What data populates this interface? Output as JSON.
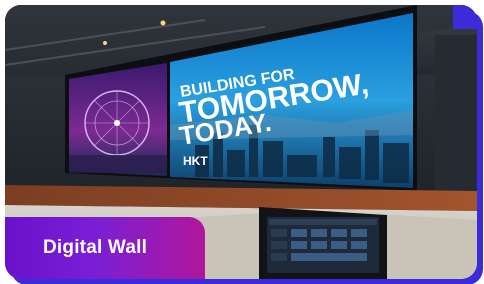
{
  "card": {
    "label": "Digital Wall"
  },
  "screen": {
    "headline_line1": "BUILDING FOR",
    "headline_line2": "TOMORROW,",
    "headline_line3": "TODAY.",
    "brand": "HKT"
  },
  "colors": {
    "label_gradient_start": "#6a11cb",
    "label_gradient_end": "#b0179a",
    "accent": "#3b2bd8"
  }
}
